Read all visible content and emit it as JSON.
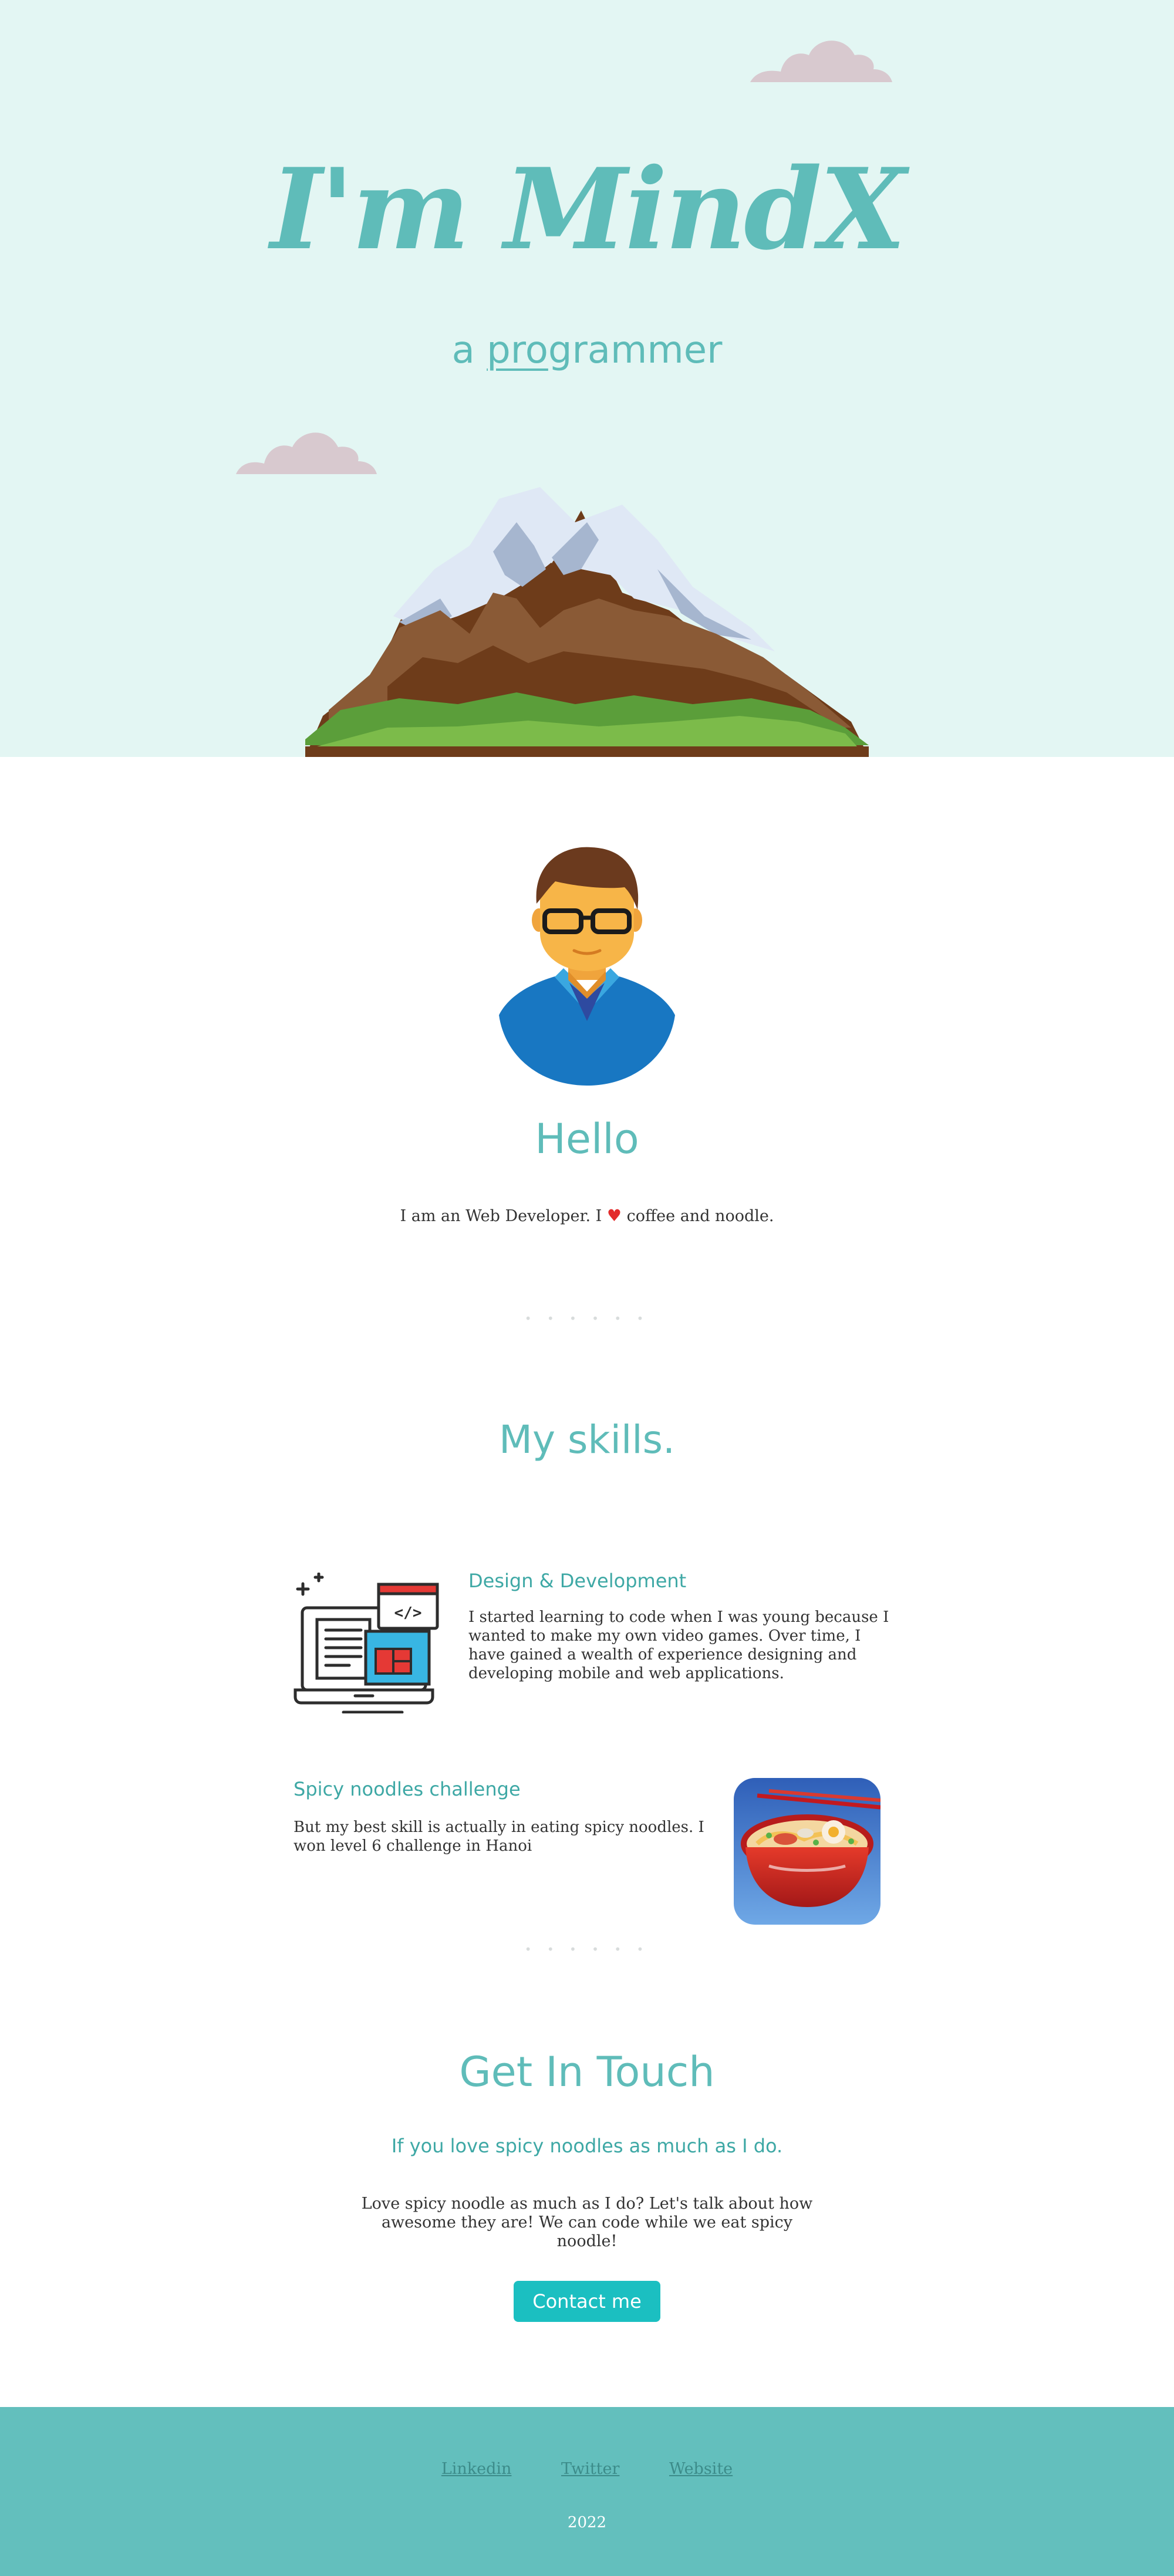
{
  "hero": {
    "title": "I'm MindX",
    "subtitle_prefix": "a ",
    "subtitle_underlined": "pro",
    "subtitle_suffix": "grammer"
  },
  "about": {
    "heading": "Hello",
    "intro_before": "I am an Web Developer. I",
    "intro_icon": "heart-icon",
    "intro_after": "coffee and noodle."
  },
  "separator": "• • • • • •",
  "skills": {
    "heading": "My skills.",
    "items": [
      {
        "title": "Design & Development",
        "text": "I started learning to code when I was young because I wanted to make my own video games. Over time, I have gained a wealth of experience designing and developing mobile and web applications.",
        "icon": "code-laptop-icon"
      },
      {
        "title": "Spicy noodles challenge",
        "text": "But my best skill is actually in eating spicy noodles. I won level 6 challenge in Hanoi",
        "icon": "noodle-bowl-icon"
      }
    ]
  },
  "contact": {
    "heading": "Get In Touch",
    "subheading": "If you love spicy noodles as much as I do.",
    "text": "Love spicy noodle as much as I do? Let's talk about how awesome they are! We can code while we eat spicy noodle!",
    "button_label": "Contact me"
  },
  "footer": {
    "links": [
      "Linkedin",
      "Twitter",
      "Website"
    ],
    "year": "2022"
  },
  "colors": {
    "hero_bg": "#e3f6f3",
    "accent": "#5fbcb9",
    "footer_bg": "#63bfbd",
    "button": "#1bbfc1"
  }
}
